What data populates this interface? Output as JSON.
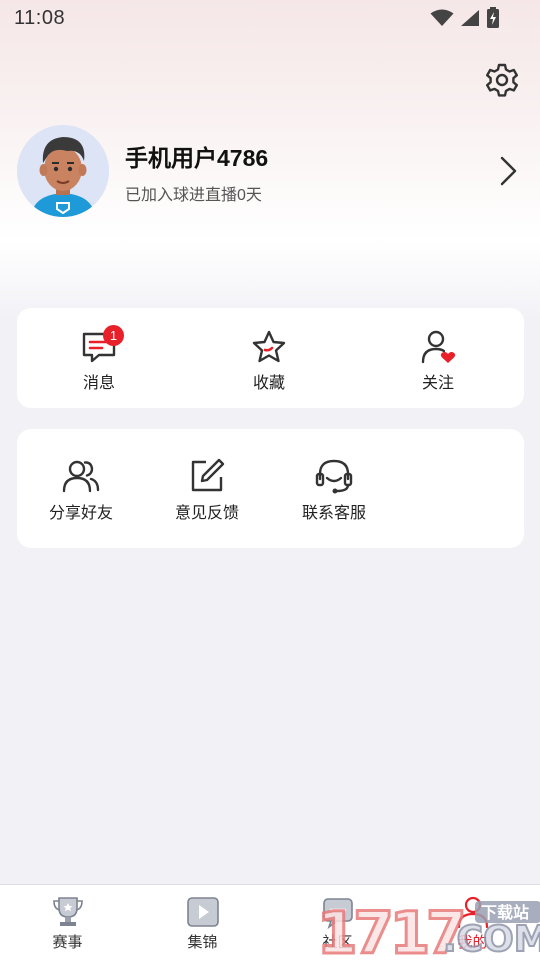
{
  "status_bar": {
    "time": "11:08"
  },
  "profile": {
    "username": "手机用户4786",
    "join_text": "已加入球进直播0天"
  },
  "quick_actions": [
    {
      "label": "消息",
      "icon": "message-icon",
      "badge": "1"
    },
    {
      "label": "收藏",
      "icon": "star-icon"
    },
    {
      "label": "关注",
      "icon": "follow-icon"
    }
  ],
  "tools": [
    {
      "label": "分享好友",
      "icon": "friends-icon"
    },
    {
      "label": "意见反馈",
      "icon": "edit-icon"
    },
    {
      "label": "联系客服",
      "icon": "headset-icon"
    }
  ],
  "tabbar": [
    {
      "label": "赛事",
      "icon": "trophy-icon"
    },
    {
      "label": "集锦",
      "icon": "play-icon"
    },
    {
      "label": "社区",
      "icon": "community-icon"
    },
    {
      "label": "我的",
      "icon": "user-icon",
      "active": true
    }
  ],
  "watermark": {
    "text": "17178.COM",
    "sub": "下载站"
  },
  "colors": {
    "accent": "#e8202a",
    "background": "#f2f1f6",
    "card": "#ffffff"
  }
}
